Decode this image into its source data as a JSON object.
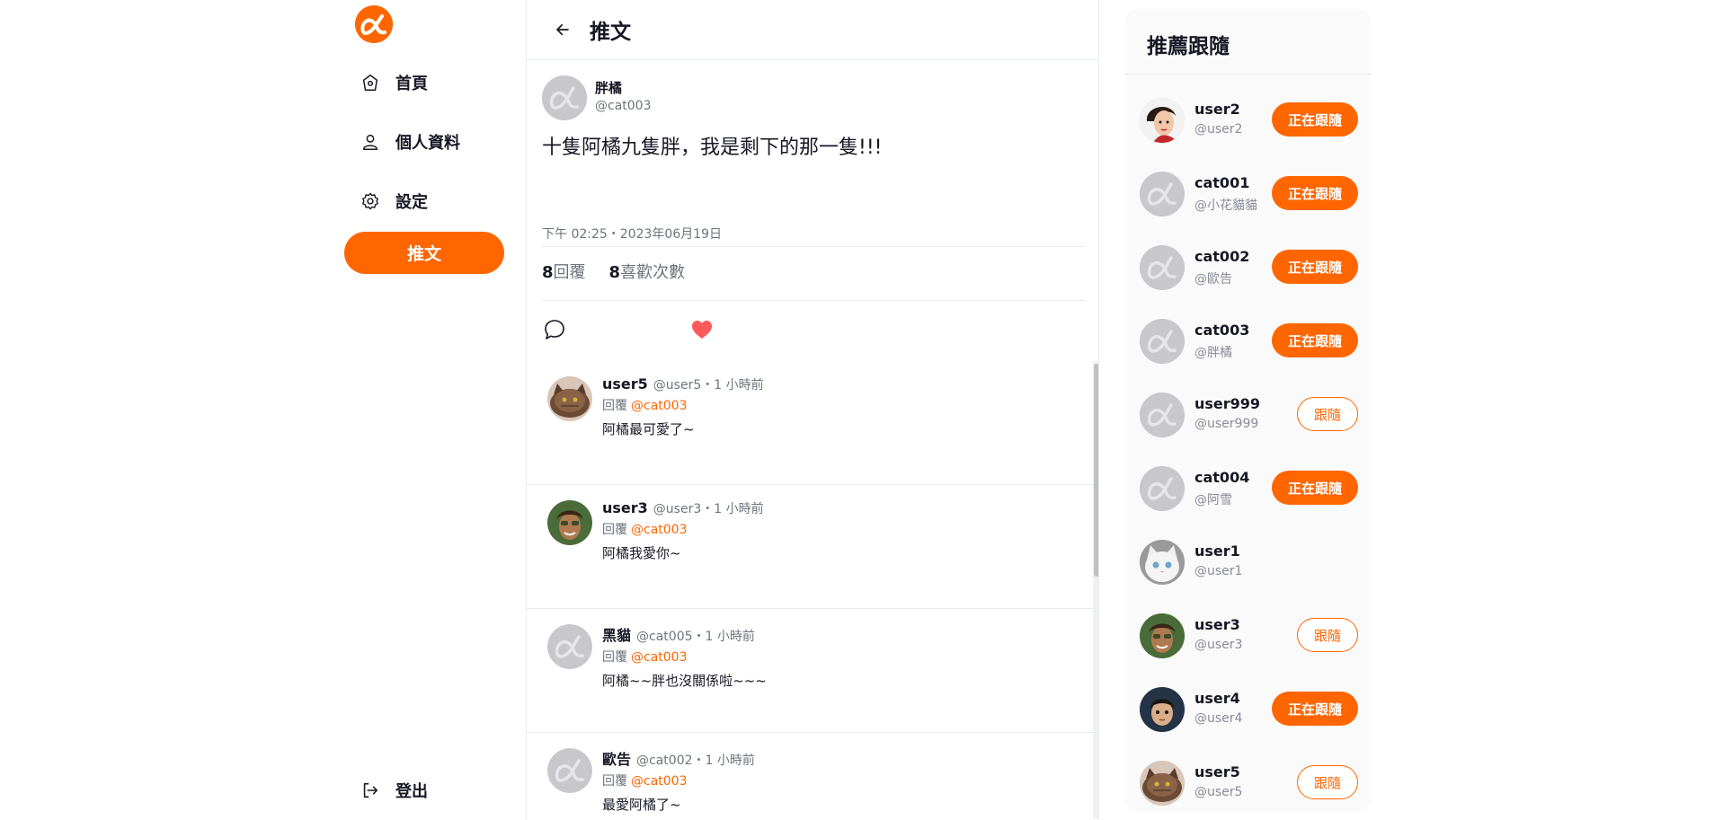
{
  "colors": {
    "accent": "#ff6600",
    "heart": "#fc5a5a",
    "avatar_default": "#c7c7cc"
  },
  "sidebar": {
    "logo_icon": "alpha-logo-icon",
    "items": [
      {
        "label": "首頁",
        "icon": "home-icon"
      },
      {
        "label": "個人資料",
        "icon": "user-icon"
      },
      {
        "label": "設定",
        "icon": "gear-icon"
      }
    ],
    "tweet_button": "推文",
    "logout": {
      "label": "登出",
      "icon": "logout-icon"
    }
  },
  "main": {
    "title": "推文",
    "back_icon": "arrow-left-icon",
    "post": {
      "name": "胖橘",
      "account": "@cat003",
      "text": "十隻阿橘九隻胖，我是剩下的那一隻!!!",
      "time": "下午 02:25・2023年06月19日",
      "reply_count": "8",
      "reply_label": "回覆",
      "like_count": "8",
      "like_label": "喜歡次數"
    },
    "replies": [
      {
        "name": "user5",
        "meta": "@user5・1 小時前",
        "reply_prefix": "回覆",
        "reply_to": "@cat003",
        "text": "阿橘最可愛了~",
        "avatar": "cat"
      },
      {
        "name": "user3",
        "meta": "@user3・1 小時前",
        "reply_prefix": "回覆",
        "reply_to": "@cat003",
        "text": "阿橘我愛你~",
        "avatar": "woman"
      },
      {
        "name": "黑貓",
        "meta": "@cat005・1 小時前",
        "reply_prefix": "回覆",
        "reply_to": "@cat003",
        "text": "阿橘~~胖也沒關係啦~~~",
        "avatar": "default"
      },
      {
        "name": "歐告",
        "meta": "@cat002・1 小時前",
        "reply_prefix": "回覆",
        "reply_to": "@cat003",
        "text": "最愛阿橘了~",
        "avatar": "default"
      }
    ]
  },
  "recommend": {
    "title": "推薦跟隨",
    "users": [
      {
        "name": "user2",
        "account": "@user2",
        "button": "正在跟隨",
        "following": true,
        "avatar": "woman-red"
      },
      {
        "name": "cat001",
        "account": "@小花貓貓",
        "button": "正在跟隨",
        "following": true,
        "avatar": "default"
      },
      {
        "name": "cat002",
        "account": "@歐告",
        "button": "正在跟隨",
        "following": true,
        "avatar": "default"
      },
      {
        "name": "cat003",
        "account": "@胖橘",
        "button": "正在跟隨",
        "following": true,
        "avatar": "default"
      },
      {
        "name": "user999",
        "account": "@user999",
        "button": "跟隨",
        "following": false,
        "avatar": "default"
      },
      {
        "name": "cat004",
        "account": "@阿雪",
        "button": "正在跟隨",
        "following": true,
        "avatar": "default"
      },
      {
        "name": "user1",
        "account": "@user1",
        "button": "",
        "following": null,
        "avatar": "white-cat"
      },
      {
        "name": "user3",
        "account": "@user3",
        "button": "跟隨",
        "following": false,
        "avatar": "woman"
      },
      {
        "name": "user4",
        "account": "@user4",
        "button": "正在跟隨",
        "following": true,
        "avatar": "child"
      },
      {
        "name": "user5",
        "account": "@user5",
        "button": "跟隨",
        "following": false,
        "avatar": "cat"
      }
    ]
  }
}
